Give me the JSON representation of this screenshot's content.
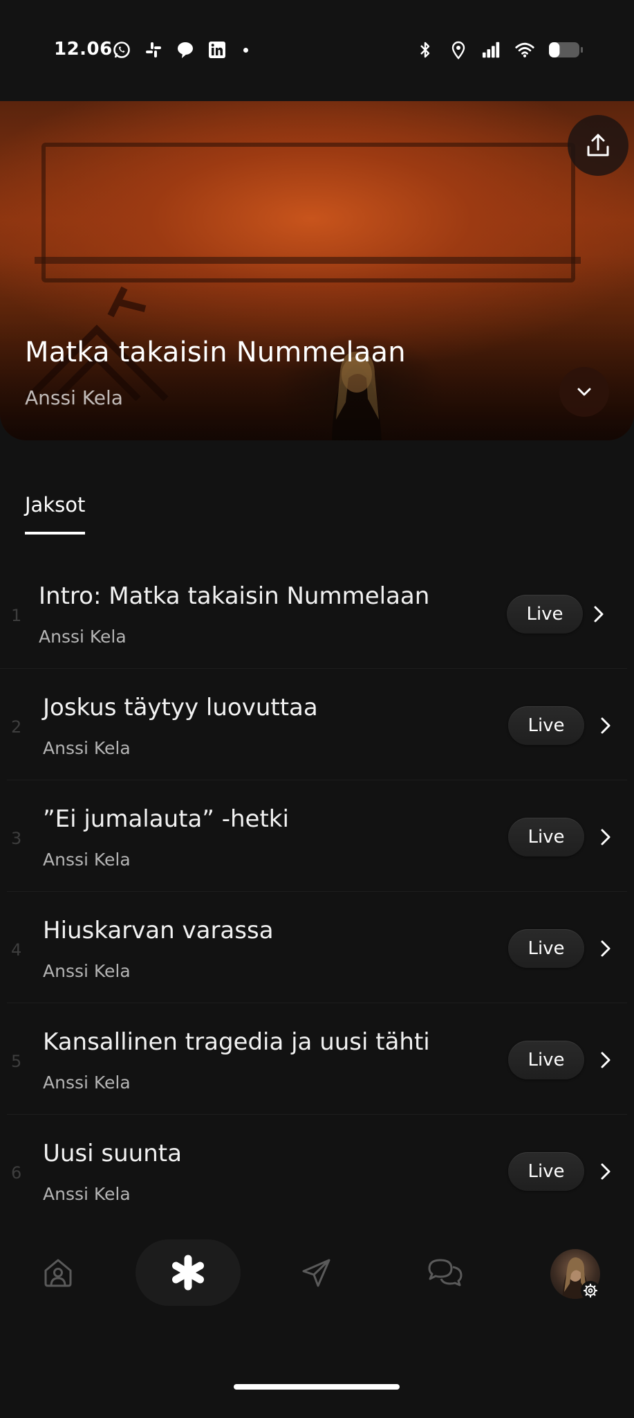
{
  "status_bar": {
    "time": "12.06",
    "left_icons": [
      "whatsapp-icon",
      "slack-icon",
      "chat-icon",
      "linkedin-icon",
      "dot-icon"
    ],
    "right_icons": [
      "bluetooth-icon",
      "location-icon",
      "signal-icon",
      "wifi-icon",
      "battery-icon"
    ],
    "battery_level": 0.35
  },
  "hero": {
    "title": "Matka takaisin Nummelaan",
    "artist": "Anssi Kela",
    "share_icon": "share-icon",
    "expand_icon": "chevron-down-icon",
    "accent_color": "#b84a16"
  },
  "tabs": [
    {
      "label": "Jaksot",
      "active": true
    }
  ],
  "episodes": [
    {
      "number": "1",
      "title": "Intro: Matka takaisin Nummelaan",
      "artist": "Anssi Kela",
      "action": "Live"
    },
    {
      "number": "2",
      "title": "Joskus täytyy luovuttaa",
      "artist": "Anssi Kela",
      "action": "Live"
    },
    {
      "number": "3",
      "title": "”Ei jumalauta” -hetki",
      "artist": "Anssi Kela",
      "action": "Live"
    },
    {
      "number": "4",
      "title": "Hiuskarvan varassa",
      "artist": "Anssi Kela",
      "action": "Live"
    },
    {
      "number": "5",
      "title": "Kansallinen tragedia ja uusi tähti",
      "artist": "Anssi Kela",
      "action": "Live"
    },
    {
      "number": "6",
      "title": "Uusi suunta",
      "artist": "Anssi Kela",
      "action": "Live"
    }
  ],
  "bottom_nav": {
    "items": [
      "home-icon",
      "asterisk-icon",
      "send-icon",
      "messages-icon",
      "profile-avatar"
    ],
    "active": "asterisk-icon"
  }
}
